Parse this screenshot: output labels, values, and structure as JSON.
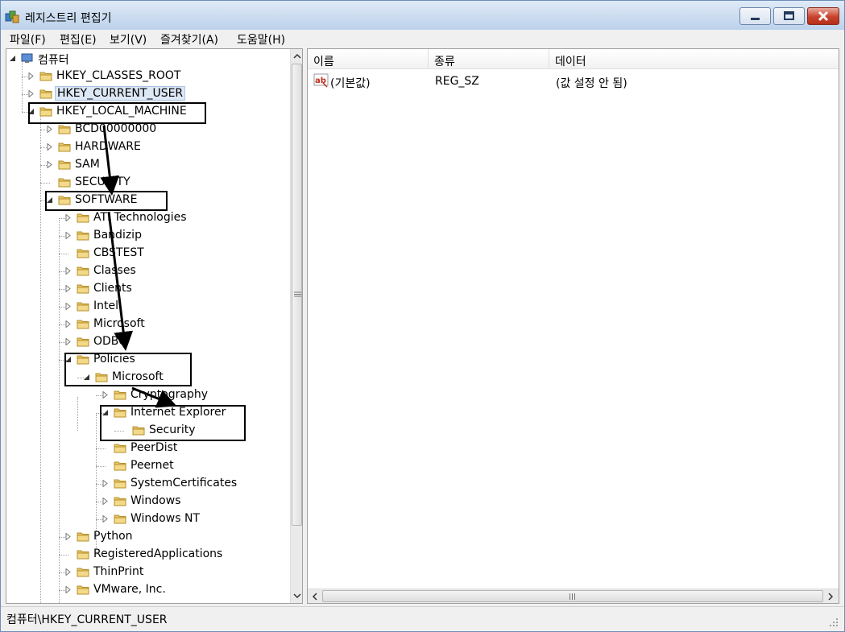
{
  "window": {
    "title": "레지스트리 편집기"
  },
  "menu": [
    "파일(F)",
    "편집(E)",
    "보기(V)",
    "즐겨찾기(A)",
    "도움말(H)"
  ],
  "tree": {
    "root": "컴퓨터",
    "hives": [
      "HKEY_CLASSES_ROOT",
      "HKEY_CURRENT_USER",
      "HKEY_LOCAL_MACHINE"
    ],
    "hklm_children": [
      "BCD00000000",
      "HARDWARE",
      "SAM",
      "SECURITY",
      "SOFTWARE"
    ],
    "software_children": [
      "ATI Technologies",
      "Bandizip",
      "CBSTEST",
      "Classes",
      "Clients",
      "Intel",
      "Microsoft",
      "ODBC",
      "Policies"
    ],
    "policies_children": [
      "Microsoft"
    ],
    "policies_ms_children": [
      "Cryptography",
      "Internet Explorer",
      "PeerDist",
      "Peernet",
      "SystemCertificates",
      "Windows",
      "Windows NT"
    ],
    "ie_children": [
      "Security"
    ],
    "software_more": [
      "Python",
      "RegisteredApplications",
      "ThinPrint",
      "VMware, Inc."
    ]
  },
  "list": {
    "columns": [
      "이름",
      "종류",
      "데이터"
    ],
    "rows": [
      {
        "name": "(기본값)",
        "type": "REG_SZ",
        "data": "(값 설정 안 됨)",
        "icon": "ab-string-icon"
      }
    ]
  },
  "status": {
    "path": "컴퓨터\\HKEY_CURRENT_USER"
  },
  "colors": {
    "selection": "#dde8f5",
    "annotation": "#000000",
    "title_bar": "#cfdff1"
  }
}
